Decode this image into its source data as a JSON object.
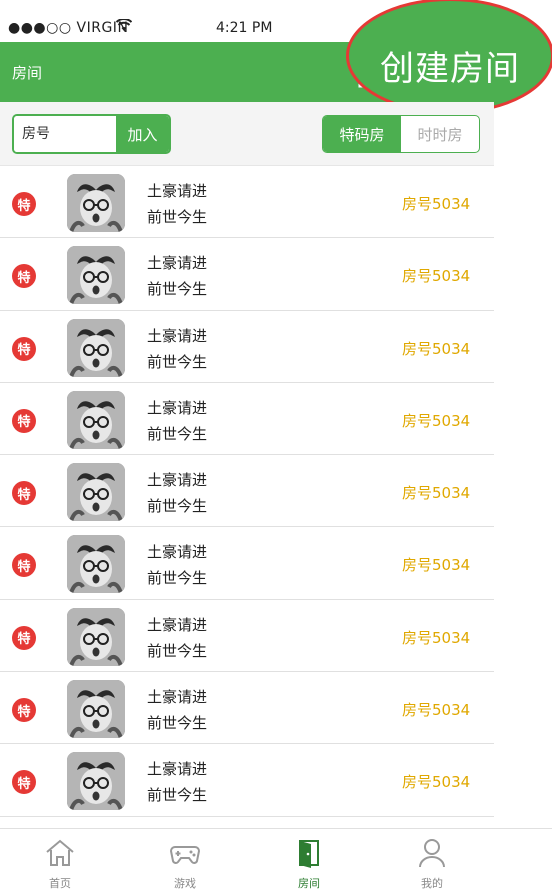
{
  "status_bar": {
    "carrier": "●●●○○ VIRGIN",
    "wifi_icon": "wifi-icon",
    "time": "4:21 PM"
  },
  "nav": {
    "title": "房间",
    "home_icon": "home-icon"
  },
  "callout": {
    "label": "创建房间"
  },
  "search": {
    "placeholder": "房号",
    "value": "",
    "join_label": "加入"
  },
  "segments": [
    {
      "label": "特码房",
      "active": true
    },
    {
      "label": "时时房",
      "active": false
    }
  ],
  "rooms": [
    {
      "badge": "特",
      "title": "土豪请进",
      "subtitle": "前世今生",
      "room_no": "房号5034"
    },
    {
      "badge": "特",
      "title": "土豪请进",
      "subtitle": "前世今生",
      "room_no": "房号5034"
    },
    {
      "badge": "特",
      "title": "土豪请进",
      "subtitle": "前世今生",
      "room_no": "房号5034"
    },
    {
      "badge": "特",
      "title": "土豪请进",
      "subtitle": "前世今生",
      "room_no": "房号5034"
    },
    {
      "badge": "特",
      "title": "土豪请进",
      "subtitle": "前世今生",
      "room_no": "房号5034"
    },
    {
      "badge": "特",
      "title": "土豪请进",
      "subtitle": "前世今生",
      "room_no": "房号5034"
    },
    {
      "badge": "特",
      "title": "土豪请进",
      "subtitle": "前世今生",
      "room_no": "房号5034"
    },
    {
      "badge": "特",
      "title": "土豪请进",
      "subtitle": "前世今生",
      "room_no": "房号5034"
    },
    {
      "badge": "特",
      "title": "土豪请进",
      "subtitle": "前世今生",
      "room_no": "房号5034"
    }
  ],
  "tabs": [
    {
      "label": "首页",
      "icon": "home-icon",
      "active": false
    },
    {
      "label": "游戏",
      "icon": "gamepad-icon",
      "active": false
    },
    {
      "label": "房间",
      "icon": "door-icon",
      "active": true
    },
    {
      "label": "我的",
      "icon": "user-icon",
      "active": false
    }
  ],
  "colors": {
    "primary": "#4caf50",
    "badge": "#e53935",
    "room_number": "#e0a800",
    "callout_border": "#e53935"
  }
}
